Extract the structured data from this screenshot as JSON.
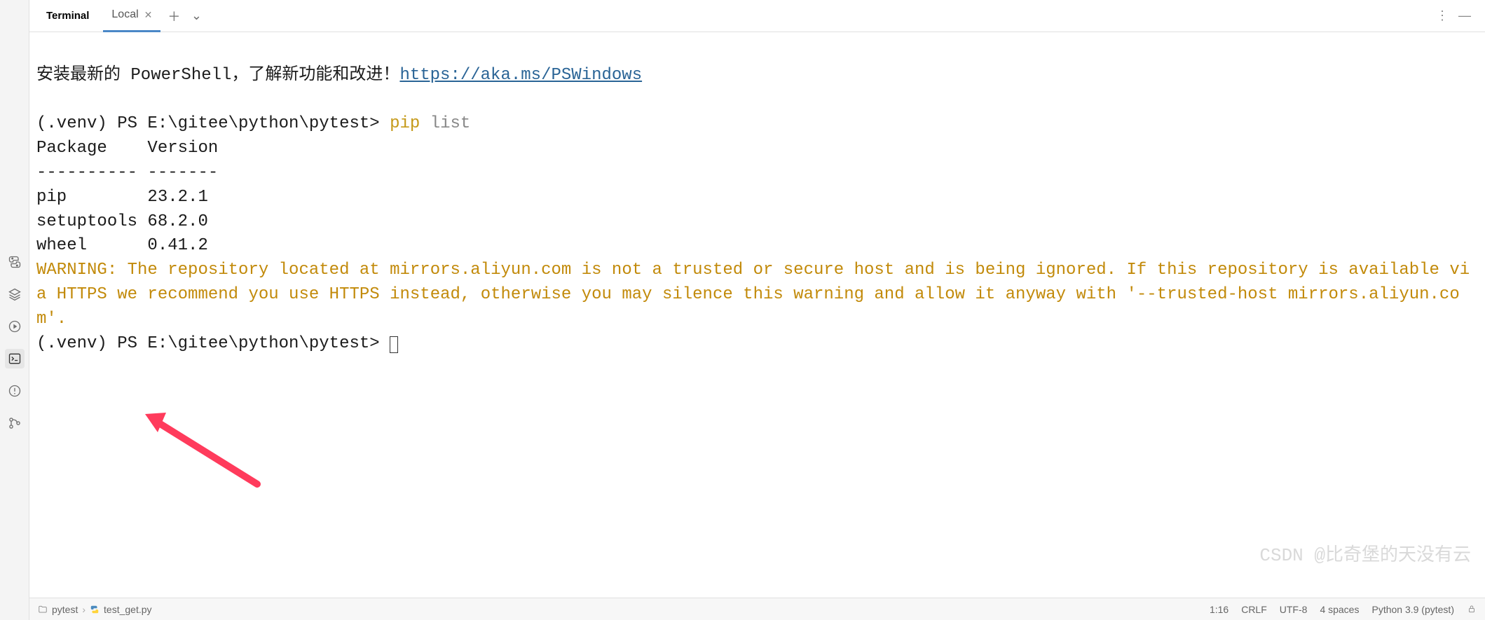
{
  "tabbar": {
    "panel_title": "Terminal",
    "tab_label": "Local"
  },
  "terminal": {
    "line1_pre": "安装最新的 PowerShell，了解新功能和改进！",
    "line1_link": "https://aka.ms/PSWindows",
    "prompt": "(.venv) PS E:\\gitee\\python\\pytest> ",
    "cmd_pip": "pip",
    "cmd_list": " list",
    "header": "Package    Version",
    "divider": "---------- -------",
    "row1": "pip        23.2.1",
    "row2": "setuptools 68.2.0",
    "row3": "wheel      0.41.2",
    "warn": "WARNING: The repository located at mirrors.aliyun.com is not a trusted or secure host and is being ignored. If this repository is available via HTTPS we recommend you use HTTPS instead, otherwise you may silence this warning and allow it anyway with '--trusted-host mirrors.aliyun.com'.",
    "prompt2": "(.venv) PS E:\\gitee\\python\\pytest> "
  },
  "status": {
    "crumb1": "pytest",
    "crumb2": "test_get.py",
    "pos": "1:16",
    "eol": "CRLF",
    "enc": "UTF-8",
    "indent": "4 spaces",
    "interp": "Python 3.9 (pytest)"
  },
  "watermark": "CSDN @比奇堡的天没有云"
}
